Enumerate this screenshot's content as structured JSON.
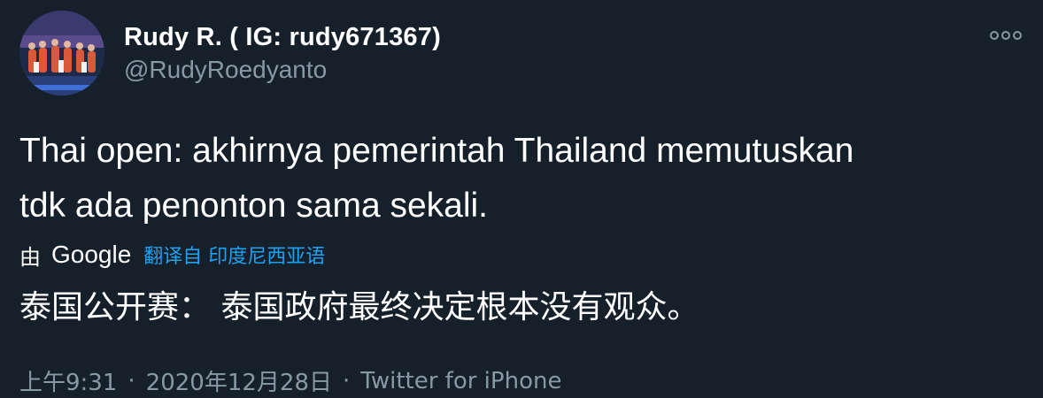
{
  "author": {
    "display_name": "Rudy R. ( IG: rudy671367)",
    "handle": "@RudyRoedyanto",
    "avatar_icon": "team-photo-avatar"
  },
  "more_menu_icon": "more-horizontal-icon",
  "tweet": {
    "text": "Thai open: akhirnya pemerintah Thailand memutuskan\ntdk ada penonton sama sekali."
  },
  "translation": {
    "by_label": "由",
    "provider": "Google",
    "link_label": "翻译自 印度尼西亚语",
    "text": "泰国公开赛：  泰国政府最终决定根本没有观众。"
  },
  "meta": {
    "time": "上午9:31",
    "separator": "·",
    "date": "2020年12月28日",
    "source": "Twitter for iPhone"
  },
  "colors": {
    "background": "#15202b",
    "primary_text": "#ffffff",
    "secondary_text": "#8899a6",
    "link": "#1da1f2"
  }
}
